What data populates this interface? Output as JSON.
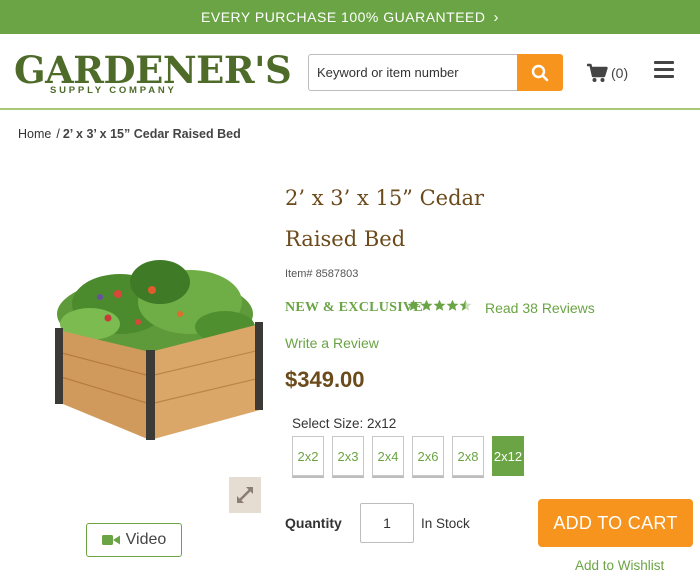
{
  "promo": {
    "text": "EVERY PURCHASE 100% GUARANTEED",
    "chevron": "›"
  },
  "header": {
    "logo_word": "GARDENER'S",
    "logo_sub": "SUPPLY COMPANY",
    "search_placeholder": "Keyword or item number",
    "cart_count": "(0)"
  },
  "breadcrumb": {
    "home": "Home",
    "separator": "/",
    "current": "2’ x 3’ x 15” Cedar Raised Bed"
  },
  "product": {
    "title": "2’ x 3’ x 15” Cedar Raised Bed",
    "item_number": "Item# 8587803",
    "tagline": "NEW & EXCLUSIVE",
    "rating": 4.5,
    "rating_max": 5,
    "reviews_link": "Read 38 Reviews",
    "write_review": "Write a Review",
    "price": "$349.00",
    "size_label": "Select Size: 2x12",
    "sizes": [
      "2x2",
      "2x3",
      "2x4",
      "2x6",
      "2x8",
      "2x12"
    ],
    "selected_size": "2x12",
    "quantity_label": "Quantity",
    "quantity_value": "1",
    "stock": "In Stock",
    "add_to_cart": "ADD TO CART",
    "wishlist": "Add to Wishlist",
    "video_label": "Video"
  },
  "colors": {
    "brand_green": "#6aa444",
    "accent_orange": "#f7941d",
    "title_brown": "#6b4a1c"
  },
  "icons": [
    "search-icon",
    "cart-icon",
    "hamburger-menu-icon",
    "star-icon",
    "expand-icon",
    "video-camera-icon"
  ]
}
